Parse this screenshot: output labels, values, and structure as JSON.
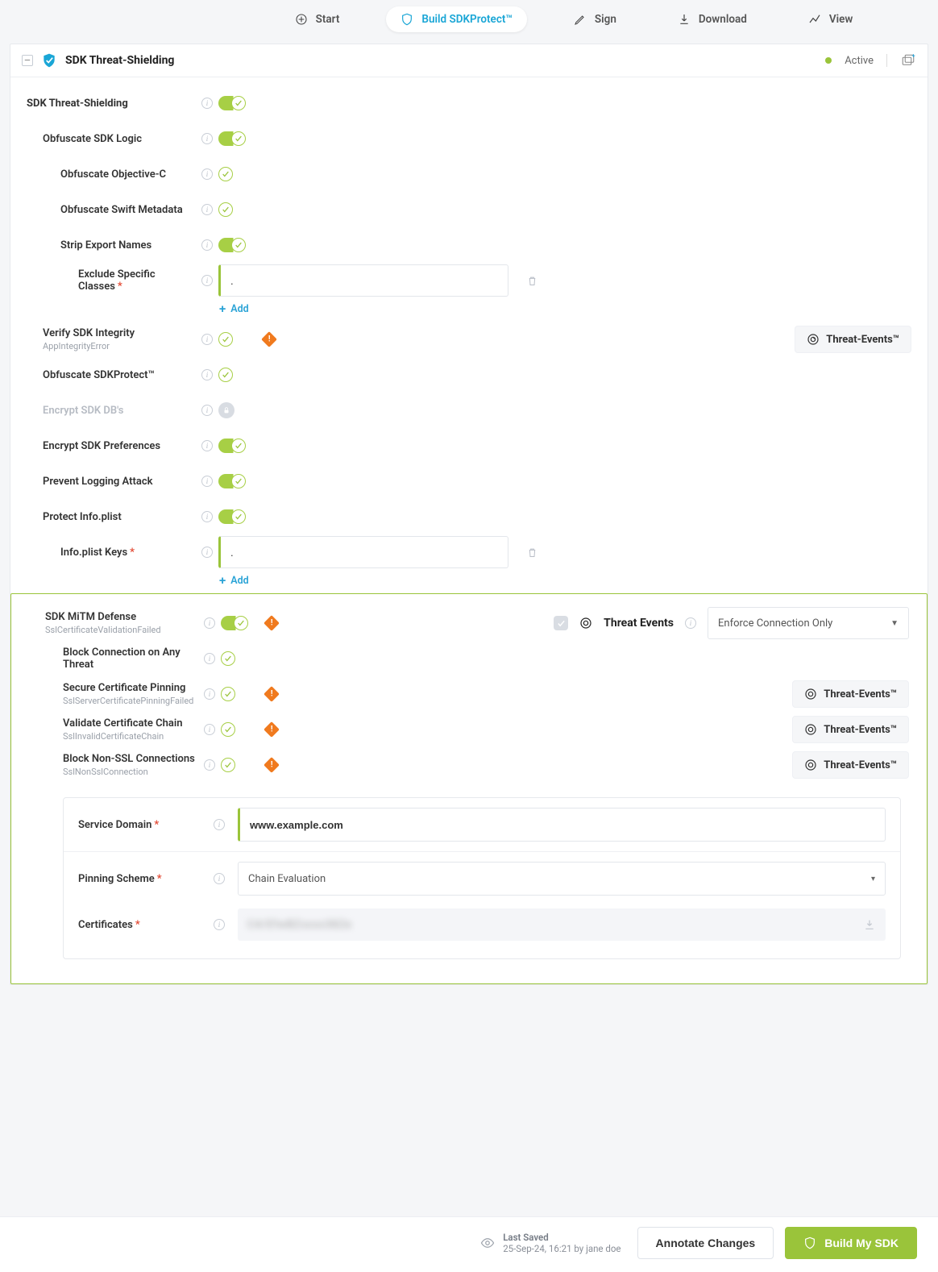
{
  "nav": {
    "items": [
      {
        "label": "Start"
      },
      {
        "label": "Build SDKProtect™"
      },
      {
        "label": "Sign"
      },
      {
        "label": "Download"
      },
      {
        "label": "View"
      }
    ]
  },
  "header": {
    "title": "SDK Threat-Shielding",
    "status": "Active"
  },
  "sectionTitle": "SDK Threat-Shielding",
  "groups": {
    "obfuscate": {
      "label": "Obfuscate SDK Logic",
      "objc": {
        "label": "Obfuscate Objective-C"
      },
      "swift": {
        "label": "Obfuscate Swift Metadata"
      },
      "strip": {
        "label": "Strip Export Names"
      },
      "exclude": {
        "label": "Exclude Specific Classes",
        "value": ".",
        "add": "Add"
      }
    },
    "integrity": {
      "label": "Verify SDK Integrity",
      "sub": "AppIntegrityError"
    },
    "obfprotect": {
      "label": "Obfuscate SDKProtect™"
    },
    "encryptdb": {
      "label": "Encrypt SDK DB's"
    },
    "prefs": {
      "label": "Encrypt SDK Preferences"
    },
    "logging": {
      "label": "Prevent Logging Attack"
    },
    "plist": {
      "label": "Protect Info.plist",
      "keys": {
        "label": "Info.plist Keys",
        "value": ".",
        "add": "Add"
      }
    }
  },
  "threatEventsPill": "Threat-Events™",
  "mitm": {
    "label": "SDK MiTM Defense",
    "sub": "SslCertificateValidationFailed",
    "teLabel": "Threat Events",
    "teSelect": "Enforce Connection Only",
    "block": {
      "label": "Block Connection on Any Threat"
    },
    "pin": {
      "label": "Secure Certificate Pinning",
      "sub": "SslServerCertificatePinningFailed"
    },
    "chain": {
      "label": "Validate Certificate Chain",
      "sub": "SslInvalidCertificateChain"
    },
    "nonssl": {
      "label": "Block Non-SSL Connections",
      "sub": "SslNonSslConnection"
    },
    "form": {
      "domain": {
        "label": "Service Domain",
        "value": "www.example.com"
      },
      "scheme": {
        "label": "Pinning Scheme",
        "value": "Chain Evaluation"
      },
      "certs": {
        "label": "Certificates",
        "blur": "C4/EfwBZxxxx38Ze"
      }
    }
  },
  "footer": {
    "savedLabel": "Last Saved",
    "savedWhen": "25-Sep-24, 16:21 by jane doe",
    "annotate": "Annotate Changes",
    "build": "Build My SDK"
  }
}
